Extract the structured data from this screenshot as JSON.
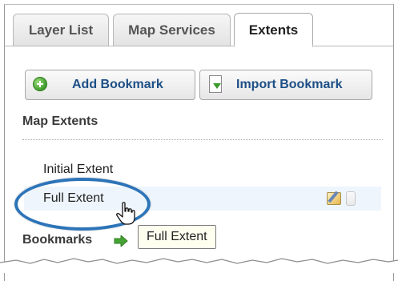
{
  "tabs": [
    {
      "label": "Layer List",
      "active": false
    },
    {
      "label": "Map Services",
      "active": false
    },
    {
      "label": "Extents",
      "active": true
    }
  ],
  "toolbar": {
    "add_bookmark_label": "Add Bookmark",
    "import_bookmark_label": "Import Bookmark"
  },
  "map_extents": {
    "title": "Map Extents",
    "items": [
      {
        "label": "Initial Extent"
      },
      {
        "label": "Full Extent"
      }
    ]
  },
  "bookmarks": {
    "title": "Bookmarks"
  },
  "tooltip": {
    "text": "Full Extent"
  },
  "colors": {
    "link_blue": "#1d4f86",
    "highlight_oval": "#2d74b8",
    "hover_row": "#eef5fd"
  },
  "icons": [
    "add-icon",
    "import-icon",
    "edit-icon",
    "delete-icon",
    "hand-cursor-icon",
    "bookmark-arrow-icon"
  ]
}
